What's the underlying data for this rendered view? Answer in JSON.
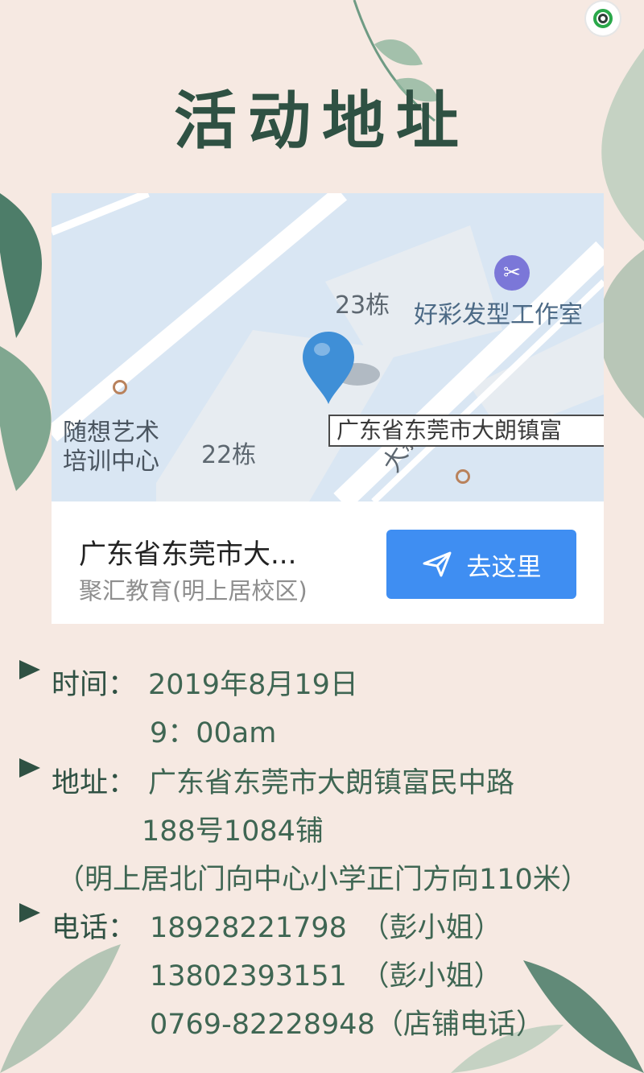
{
  "page": {
    "title": "活动地址"
  },
  "map": {
    "labels": {
      "building_23": "23栋",
      "building_22": "22栋",
      "road": "大新",
      "poi_1_line1": "随想艺术",
      "poi_1_line2": "培训中心",
      "poi_2": "好彩发型工作室"
    },
    "address_tip": "广东省东莞市大朗镇富",
    "card": {
      "title": "广东省东莞市大...",
      "subtitle": "聚汇教育(明上居校区)",
      "button_label": "去这里"
    }
  },
  "details": {
    "time_label": "时间：",
    "time_date": "2019年8月19日",
    "time_hour": "9：00am",
    "address_label": "地址：",
    "address_line1": "广东省东莞市大朗镇富民中路",
    "address_line2": "188号1084铺",
    "address_line3": "（明上居北门向中心小学正门方向110米）",
    "phone_label": "电话：",
    "phone_1": "18928221798　（彭小姐）",
    "phone_2": "13802393151　（彭小姐）",
    "phone_3": "0769-82228948（店铺电话）"
  },
  "colors": {
    "background": "#f6e9e2",
    "accent_green": "#2f5143",
    "button_blue": "#3f8ef2",
    "map_water": "#d9e6f3"
  },
  "icons": {
    "logo": "brand-logo-icon",
    "pin": "map-pin-icon",
    "scissors": "scissors-icon",
    "navigate": "send-arrow-icon"
  }
}
